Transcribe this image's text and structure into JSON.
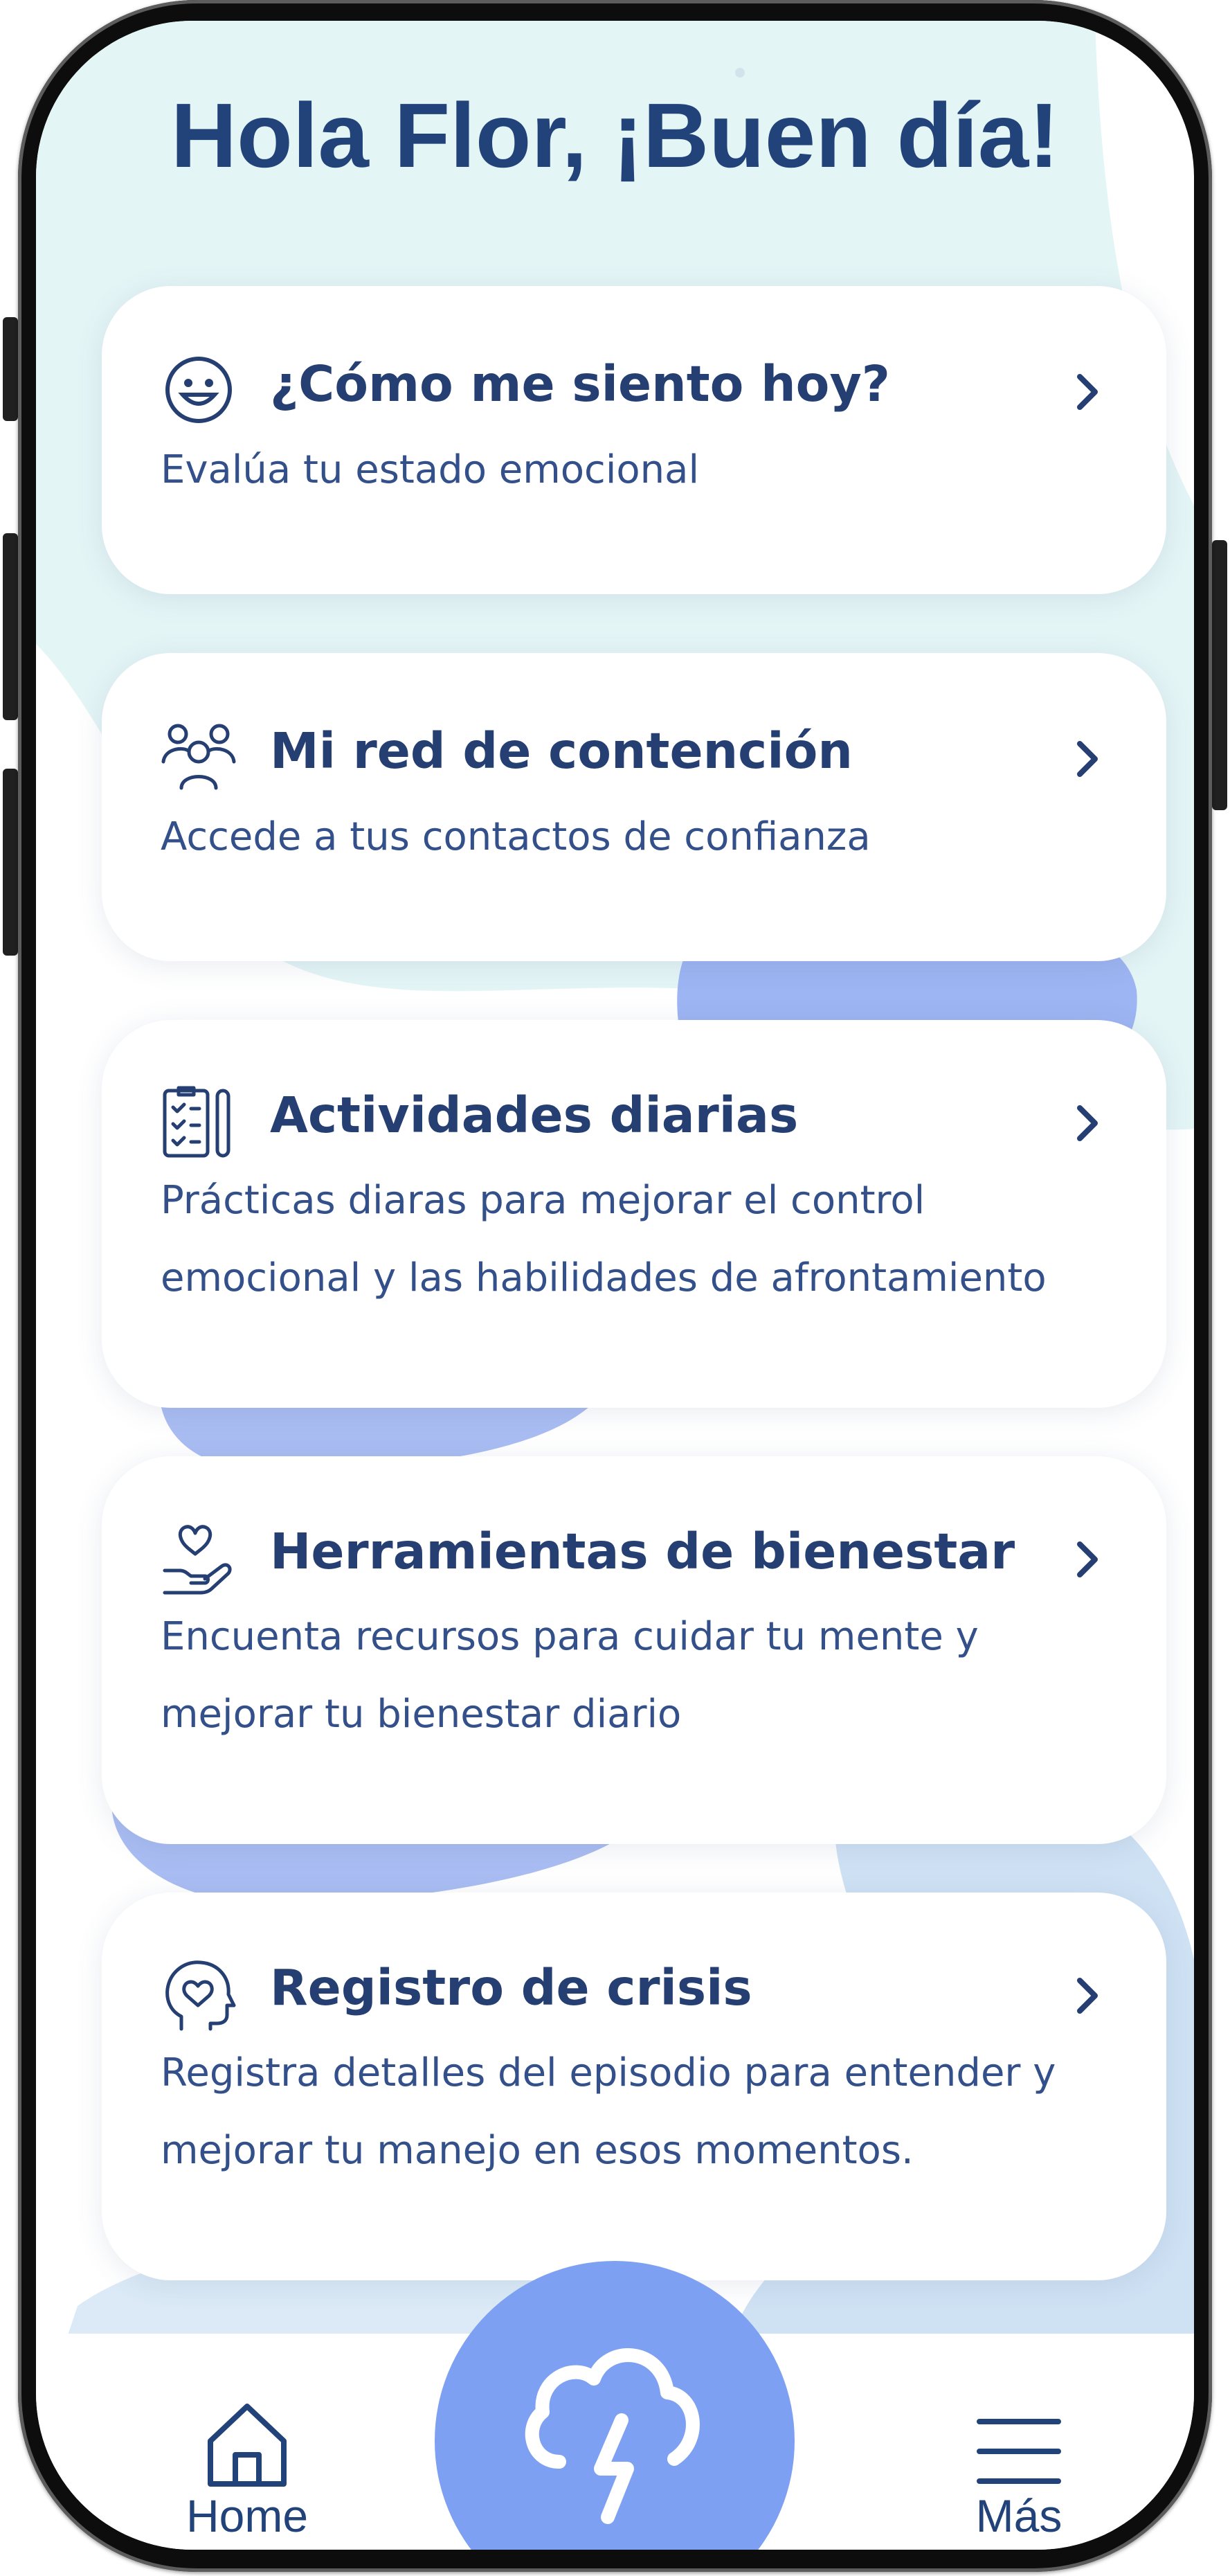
{
  "greeting": "Hola Flor, ¡Buen día!",
  "cards": [
    {
      "title": "¿Cómo me siento hoy?",
      "description": [
        "Evalúa tu estado emocional"
      ],
      "icon": "smiley-face-icon"
    },
    {
      "title": "Mi red de contención",
      "description": [
        "Accede a tus contactos de confianza"
      ],
      "icon": "people-group-icon"
    },
    {
      "title": "Actividades diarias",
      "description": [
        "Prácticas diaras para mejorar el control",
        "emocional y las habilidades de afrontamiento"
      ],
      "icon": "checklist-icon"
    },
    {
      "title": "Herramientas de bienestar",
      "description": [
        "Encuenta recursos para cuidar tu mente y",
        "mejorar tu bienestar diario"
      ],
      "icon": "heart-hand-icon"
    },
    {
      "title": "Registro de crisis",
      "description": [
        "Registra detalles del episodio para entender y",
        "mejorar tu manejo en esos momentos."
      ],
      "icon": "head-heart-icon"
    }
  ],
  "nav": {
    "home_label": "Home",
    "more_label": "Más",
    "center_icon": "storm-cloud-icon"
  },
  "colors": {
    "title_text": "#22427a",
    "body_text": "#33508a",
    "background_mint": "#e4f5f6",
    "background_blue": "#9db5f2",
    "background_light_blue": "#cfe2f4",
    "fab": "#7ea0f3"
  }
}
